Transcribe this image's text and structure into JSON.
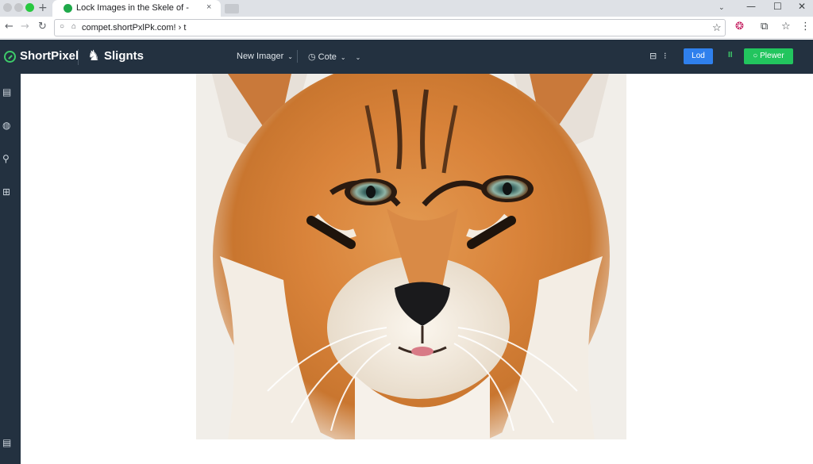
{
  "browser": {
    "tab_title": "Lock Images in the Skele of -",
    "tab_close": "×",
    "new_tab": "+",
    "url": "compet.shortPxlPk.com! › t",
    "window_controls": {
      "chevron": "⌄",
      "minimize": "—",
      "maximize": "☐",
      "close": "✕"
    },
    "nav": {
      "back": "←",
      "forward": "→",
      "reload": "↻"
    },
    "icons": {
      "info": "○",
      "lock": "🔒",
      "star": "☆",
      "ext_a": "❂",
      "ext_b": "⧉",
      "ext_c": "☆",
      "menu": "⋮"
    }
  },
  "app": {
    "logo_text": "ShortPixel",
    "brand_text": "Slignts",
    "brand_icon": "♞",
    "menu": {
      "new_image": "New Imager",
      "cote": "Cote",
      "cote_icon": "◷",
      "caret": "⌄"
    },
    "actions": {
      "save_icon": "⊟",
      "more": "⁝",
      "load_label": "Lod",
      "pause_icon": "II",
      "preview_label": "○ Plewer"
    },
    "colors": {
      "header_bg": "#233140",
      "accent_blue": "#2f80ed",
      "accent_green": "#22c55e"
    }
  },
  "sidebar": {
    "icons": [
      "▤",
      "◍",
      "⚲",
      "⊞",
      "▤"
    ]
  },
  "canvas": {
    "image_subject": "close-up of a big cat face with orange and white fur"
  }
}
